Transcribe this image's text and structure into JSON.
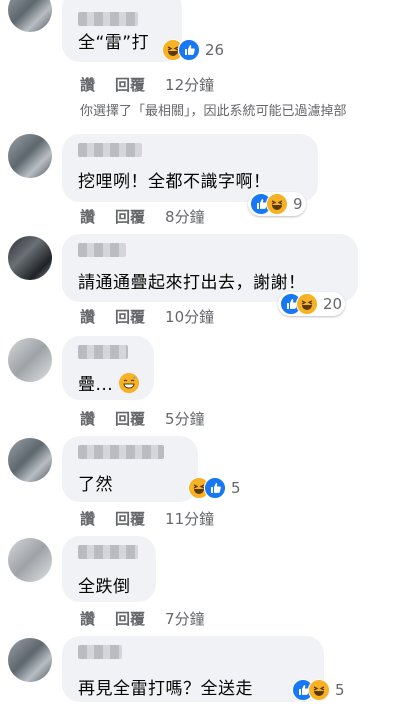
{
  "comments": [
    {
      "text": "全“雷”打",
      "reaction_count": "26",
      "actions": {
        "like": "讚",
        "reply": "回覆",
        "time": "12分鐘"
      }
    },
    {
      "text": "挖哩咧！全都不識字啊！",
      "reaction_count": "9",
      "actions": {
        "like": "讚",
        "reply": "回覆",
        "time": "8分鐘"
      }
    },
    {
      "text": "請通通疊起來打出去，謝謝！",
      "reaction_count": "20",
      "actions": {
        "like": "讚",
        "reply": "回覆",
        "time": "10分鐘"
      }
    },
    {
      "text": "疊...",
      "actions": {
        "like": "讚",
        "reply": "回覆",
        "time": "5分鐘"
      }
    },
    {
      "text": "了然",
      "reaction_count": "5",
      "actions": {
        "like": "讚",
        "reply": "回覆",
        "time": "11分鐘"
      }
    },
    {
      "text": "全跌倒",
      "actions": {
        "like": "讚",
        "reply": "回覆",
        "time": "7分鐘"
      }
    },
    {
      "text": "再見全雷打嗎？全送走",
      "reaction_count": "5"
    }
  ],
  "filter_notice": "你選擇了「最相關」，因此系統可能已過濾掉部",
  "icons": {
    "like": "like-reaction-icon",
    "haha": "haha-reaction-icon"
  },
  "colors": {
    "like": "#1877f2",
    "haha": "#f7b125",
    "bubble": "#f0f2f5",
    "meta": "#65676b"
  }
}
